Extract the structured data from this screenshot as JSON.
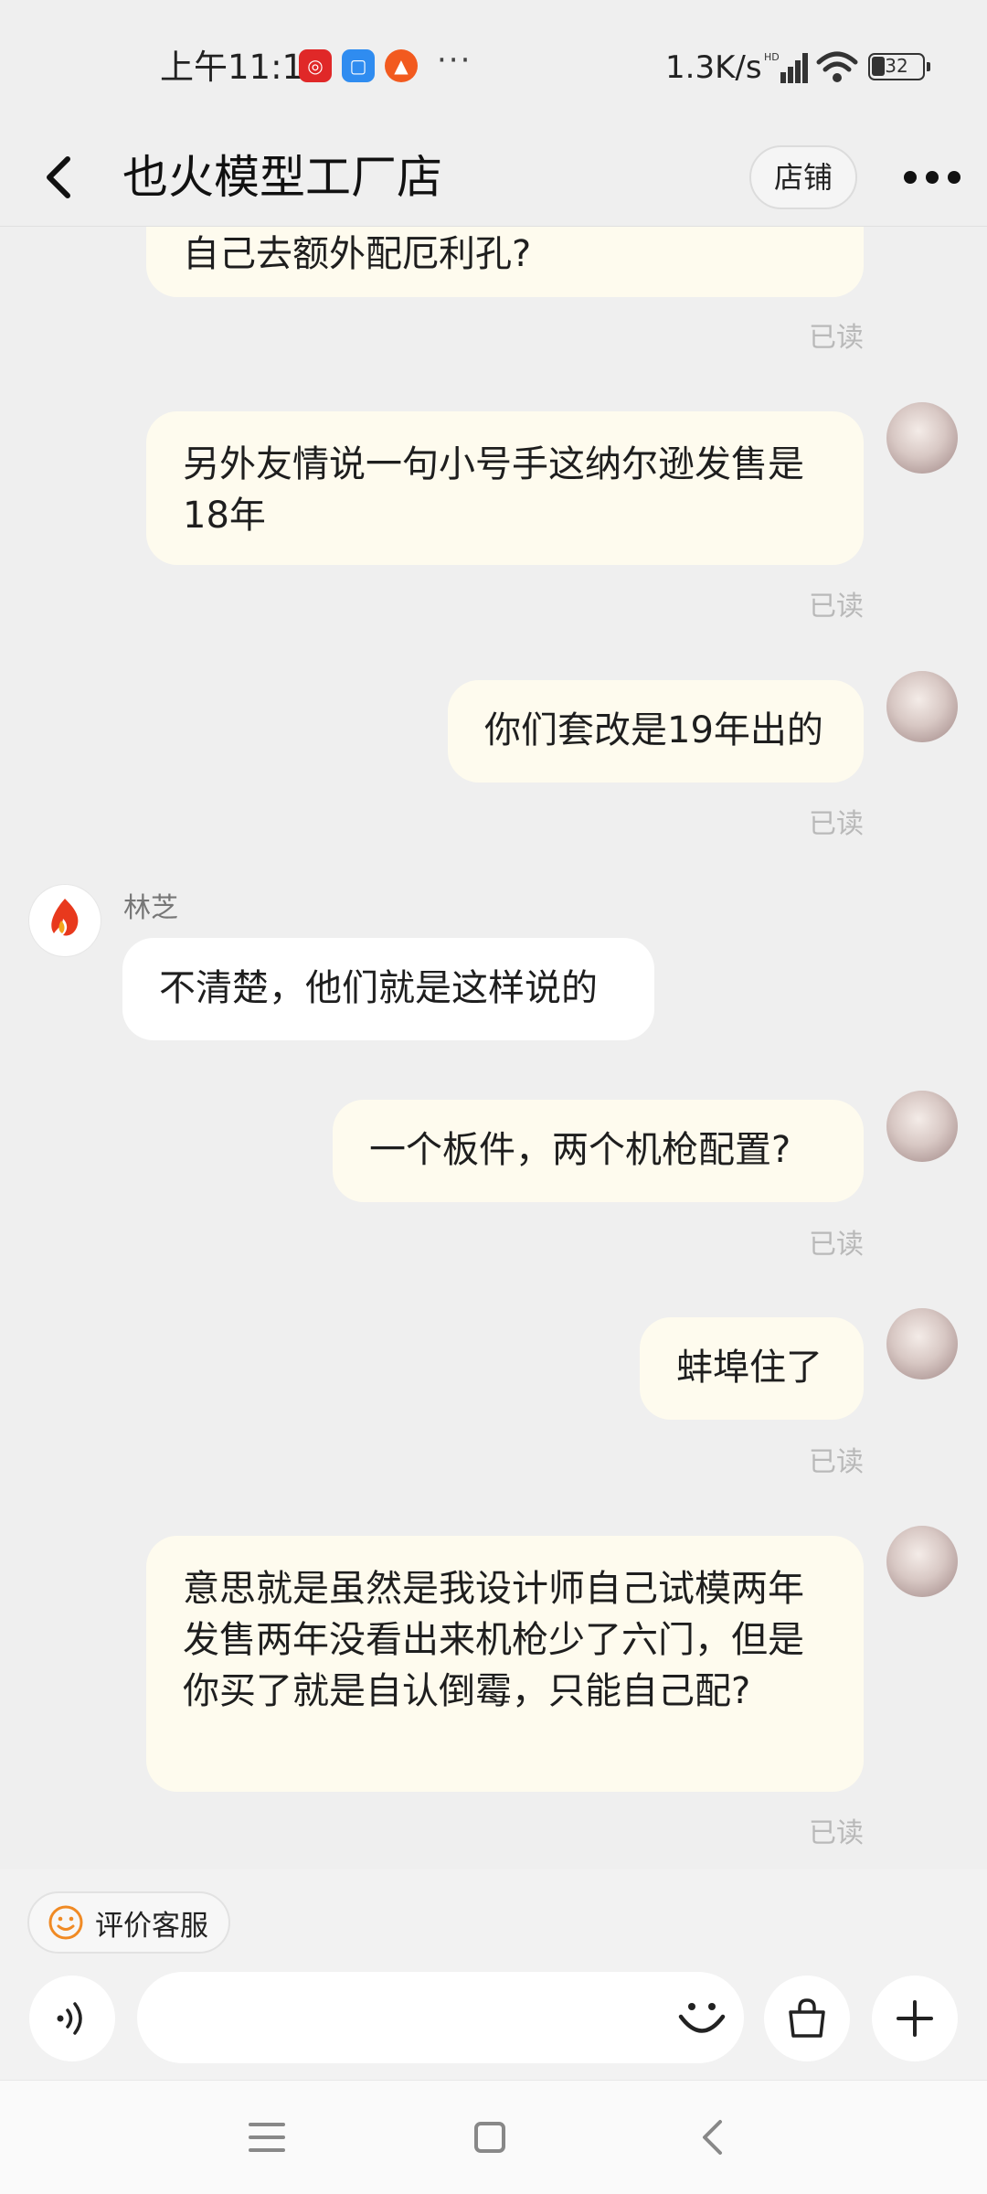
{
  "status_bar": {
    "time": "上午11:13",
    "more": "···",
    "net_speed": "1.3K/s",
    "battery": "32"
  },
  "header": {
    "title": "也火模型工厂店",
    "shop_button": "店铺"
  },
  "messages": [
    {
      "from": "me",
      "text": "自己去额外配厄利孔?",
      "status": "已读"
    },
    {
      "from": "me",
      "text": "另外友情说一句小号手这纳尔逊发售是18年",
      "status": "已读"
    },
    {
      "from": "me",
      "text": "你们套改是19年出的",
      "status": "已读"
    },
    {
      "from": "shop",
      "sender": "林芝",
      "text": "不清楚，他们就是这样说的"
    },
    {
      "from": "me",
      "text": "一个板件，两个机枪配置?",
      "status": "已读"
    },
    {
      "from": "me",
      "text": "蚌埠住了",
      "status": "已读"
    },
    {
      "from": "me",
      "text": "意思就是虽然是我设计师自己试模两年发售两年没看出来机枪少了六门，但是你买了就是自认倒霉，只能自己配?",
      "status": "已读"
    }
  ],
  "bottom": {
    "rate_label": "评价客服"
  },
  "colors": {
    "my_bubble": "#fefbee",
    "their_bubble": "#ffffff",
    "background": "#efefef",
    "brand_logo": "#e8391d"
  }
}
